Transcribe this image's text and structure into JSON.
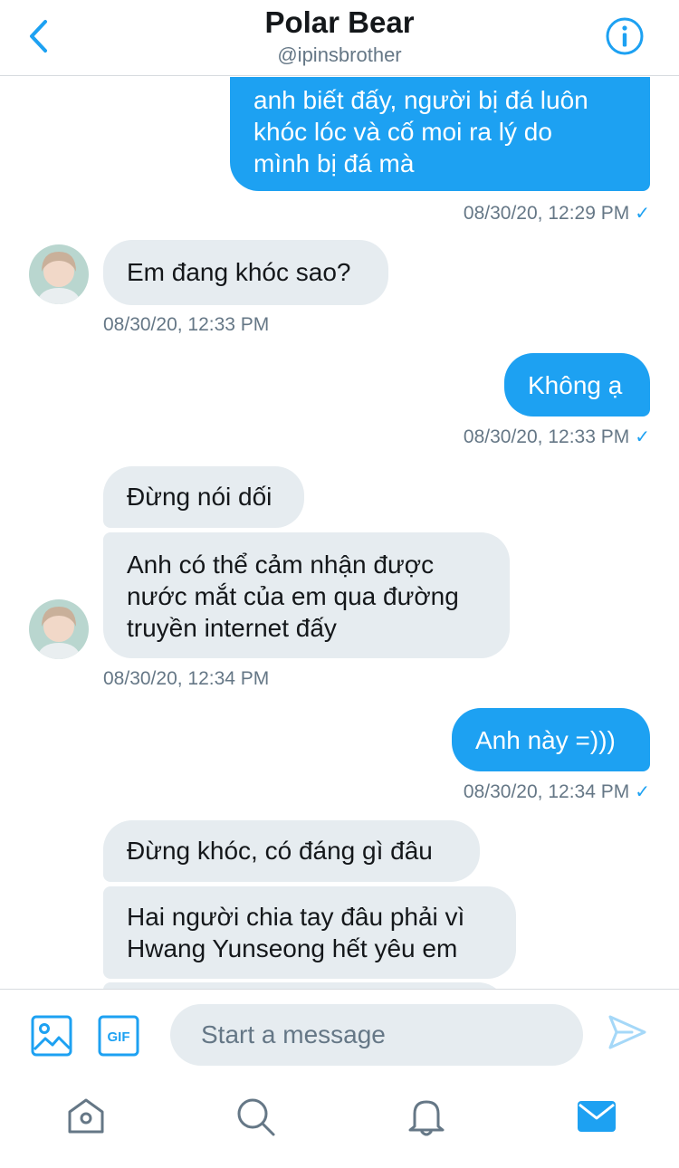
{
  "header": {
    "title": "Polar Bear",
    "handle": "@ipinsbrother"
  },
  "messages": [
    {
      "from": "me",
      "text": "anh biết đấy, người bị đá luôn\nkhóc lóc và cố moi ra lý do\nmình bị đá mà",
      "time": "08/30/20, 12:29 PM"
    },
    {
      "from": "them",
      "text": "Em đang khóc sao?",
      "time": "08/30/20, 12:33 PM"
    },
    {
      "from": "me",
      "text": "Không ạ",
      "time": "08/30/20, 12:33 PM"
    },
    {
      "from": "them",
      "text": "Đừng nói dối"
    },
    {
      "from": "them",
      "text": "Anh có thể cảm nhận được\nnước mắt của em qua đường\ntruyền internet đấy",
      "time": "08/30/20, 12:34 PM"
    },
    {
      "from": "me",
      "text": "Anh này =)))",
      "time": "08/30/20, 12:34 PM"
    },
    {
      "from": "them",
      "text": "Đừng khóc, có đáng gì đâu"
    },
    {
      "from": "them",
      "text": "Hai người chia tay đâu phải vì\nHwang Yunseong hết yêu em"
    }
  ],
  "composer": {
    "placeholder": "Start a message",
    "gif_label": "GIF"
  },
  "read_receipt": "✓",
  "colors": {
    "accent": "#1da1f2",
    "received_bubble": "#e6ecf0",
    "muted_text": "#657786"
  },
  "icons": {
    "back": "chevron-left-icon",
    "info": "info-icon",
    "image": "image-icon",
    "gif": "gif-icon",
    "send": "send-icon",
    "home": "home-icon",
    "search": "search-icon",
    "notifications": "bell-icon",
    "messages": "mail-icon"
  }
}
